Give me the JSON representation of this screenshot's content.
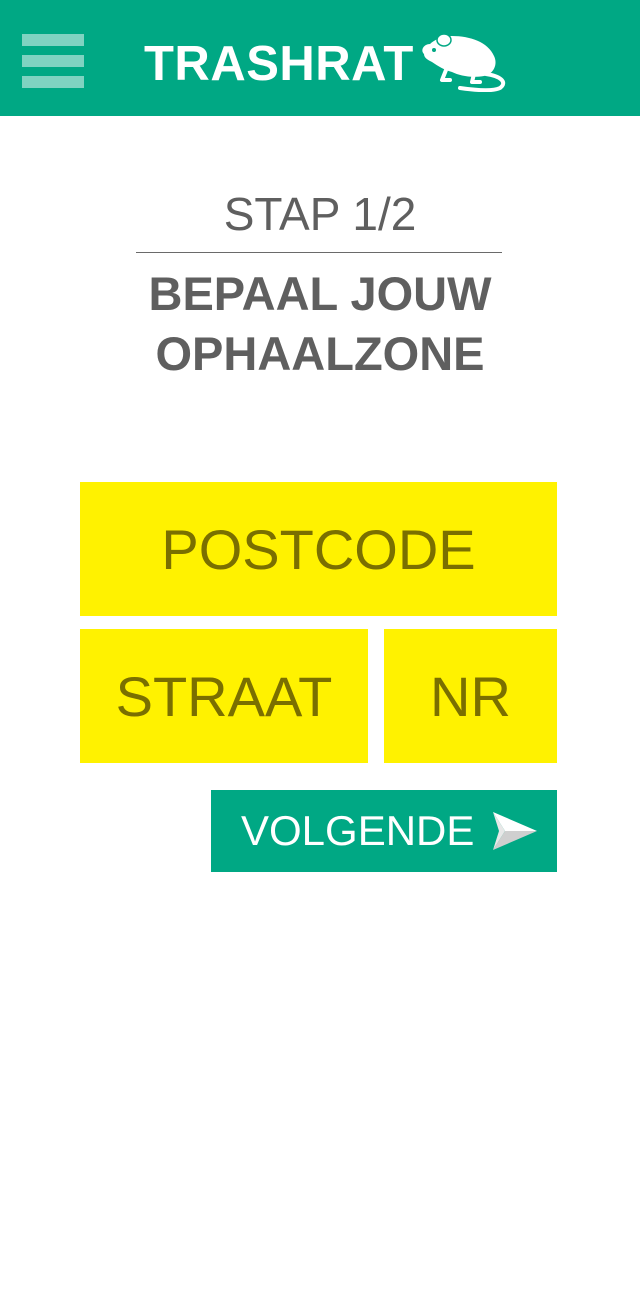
{
  "header": {
    "title": "TRASHRAT",
    "menu_icon": "hamburger-menu-icon",
    "logo_icon": "rat-icon",
    "background_color": "#00a884"
  },
  "step": {
    "label": "STAP 1/2"
  },
  "page": {
    "title_line1": "BEPAAL JOUW",
    "title_line2": "OPHAALZONE"
  },
  "form": {
    "postcode": {
      "placeholder": "POSTCODE",
      "value": ""
    },
    "straat": {
      "placeholder": "STRAAT",
      "value": ""
    },
    "nr": {
      "placeholder": "NR",
      "value": ""
    },
    "field_color": "#fff200"
  },
  "next_button": {
    "label": "VOLGENDE",
    "icon": "send-arrow-icon"
  }
}
